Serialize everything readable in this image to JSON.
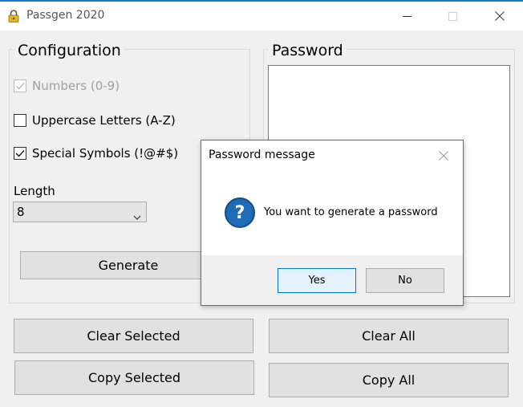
{
  "window": {
    "title": "Passgen 2020",
    "icon": "lock-icon",
    "controls": [
      "minimize-icon",
      "maximize-icon",
      "close-icon"
    ],
    "accent_color": "#1979ca"
  },
  "configuration": {
    "title": "Configuration",
    "options": [
      {
        "label": "Numbers (0-9)",
        "checked": true,
        "enabled": false
      },
      {
        "label": "Uppercase Letters (A-Z)",
        "checked": false,
        "enabled": true
      },
      {
        "label": "Special Symbols (!@#$)",
        "checked": true,
        "enabled": true
      }
    ],
    "length_label": "Length",
    "length_value": "8",
    "generate_label": "Generate"
  },
  "password": {
    "title": "Password",
    "value": ""
  },
  "buttons": {
    "clear_selected": "Clear Selected",
    "clear_all": "Clear All",
    "copy_selected": "Copy Selected",
    "copy_all": "Copy All"
  },
  "dialog": {
    "title": "Password message",
    "icon": "question-icon",
    "icon_glyph": "?",
    "message": "You want to generate a password",
    "yes_label": "Yes",
    "no_label": "No",
    "icon_color": "#1f6bb6"
  }
}
